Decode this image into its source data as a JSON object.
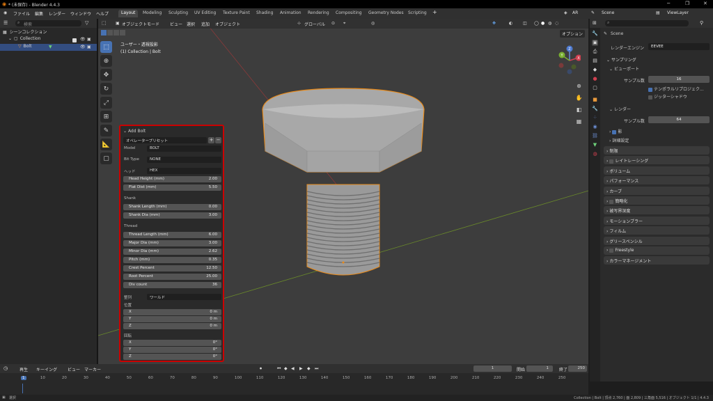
{
  "window": {
    "title": "* (未保存) - Blender 4.4.3"
  },
  "menus": [
    "ファイル",
    "編集",
    "レンダー",
    "ウィンドウ",
    "ヘルプ"
  ],
  "workspaces": [
    "Layout",
    "Modeling",
    "Sculpting",
    "UV Editing",
    "Texture Paint",
    "Shading",
    "Animation",
    "Rendering",
    "Compositing",
    "Geometry Nodes",
    "Scripting"
  ],
  "topright": {
    "ar": "AR",
    "scene": "Scene",
    "viewlayer": "ViewLayer"
  },
  "outliner": {
    "search_placeholder": "検索",
    "rows": [
      "シーンコレクション",
      "Collection",
      "Bolt"
    ]
  },
  "viewport_header": {
    "mode": "オブジェクトモード",
    "menus": [
      "ビュー",
      "選択",
      "追加",
      "オブジェクト"
    ],
    "orientation": "グローバル",
    "options": "オプション"
  },
  "viewport_overlay": {
    "line1": "ユーザー・透視投影",
    "line2": "(1) Collection | Bolt"
  },
  "gizmo": {
    "x": "X",
    "y": "Y",
    "z": "Z"
  },
  "panel": {
    "title": "Add Bolt",
    "preset": "オペレータープリセット",
    "model_label": "Model",
    "model_value": "BOLT",
    "bit_label": "Bit Type",
    "bit_value": "NONE",
    "head_label": "ヘッド",
    "head_value": "HEX",
    "head_fields": [
      {
        "label": "Head Height (mm)",
        "value": "2.00"
      },
      {
        "label": "Flat Dist (mm)",
        "value": "5.50"
      }
    ],
    "shank_section": "Shank",
    "shank_fields": [
      {
        "label": "Shank Length (mm)",
        "value": "0.00"
      },
      {
        "label": "Shank Dia (mm)",
        "value": "3.00"
      }
    ],
    "thread_section": "Thread",
    "thread_fields": [
      {
        "label": "Thread Length (mm)",
        "value": "6.00"
      },
      {
        "label": "Major Dia (mm)",
        "value": "3.00"
      },
      {
        "label": "Minor Dia (mm)",
        "value": "2.62"
      },
      {
        "label": "Pitch (mm)",
        "value": "0.35"
      },
      {
        "label": "Crest Percent",
        "value": "12.50"
      },
      {
        "label": "Root Percent",
        "value": "25.00"
      },
      {
        "label": "Div count",
        "value": "36"
      }
    ],
    "align_label": "整列",
    "align_value": "ワールド",
    "location_section": "位置",
    "location": [
      {
        "label": "X",
        "value": "0 m"
      },
      {
        "label": "Y",
        "value": "0 m"
      },
      {
        "label": "Z",
        "value": "0 m"
      }
    ],
    "rotation_section": "回転",
    "rotation": [
      {
        "label": "X",
        "value": "0°"
      },
      {
        "label": "Y",
        "value": "0°"
      },
      {
        "label": "Z",
        "value": "0°"
      }
    ]
  },
  "timeline": {
    "playback": "再生",
    "keying": "キーイング",
    "view": "ビュー",
    "marker": "マーカー",
    "current_frame": "1",
    "start_label": "開始",
    "start": "1",
    "end_label": "終了",
    "end": "250",
    "ticks": [
      "1",
      "10",
      "20",
      "30",
      "40",
      "50",
      "60",
      "70",
      "80",
      "90",
      "100",
      "110",
      "120",
      "130",
      "140",
      "150",
      "160",
      "170",
      "180",
      "190",
      "200",
      "210",
      "220",
      "230",
      "240",
      "250"
    ]
  },
  "properties": {
    "scene": "Scene",
    "render_engine_label": "レンダーエンジン",
    "render_engine": "EEVEE",
    "sampling": "サンプリング",
    "viewport": "ビューポート",
    "samples_label": "サンプル数",
    "viewport_samples": "16",
    "temporal": "テンポラルリプロジェク...",
    "jitter": "ジッターシャドウ",
    "render": "レンダー",
    "render_samples": "64",
    "shadows": "影",
    "advanced": "詳細設定",
    "sections": [
      "制限",
      "レイトレーシング",
      "ボリューム",
      "パフォーマンス",
      "カーブ",
      "簡略化",
      "被写界深度",
      "モーションブラー",
      "フィルム",
      "グリースペンシル",
      "Freestyle",
      "カラーマネージメント"
    ]
  },
  "status": {
    "left": "選択",
    "right": "Collection | Bolt | 頂点 2,760 | 面 2,809 | 三角面 5,516 | オブジェクト 1/1 | 4.4.3"
  }
}
